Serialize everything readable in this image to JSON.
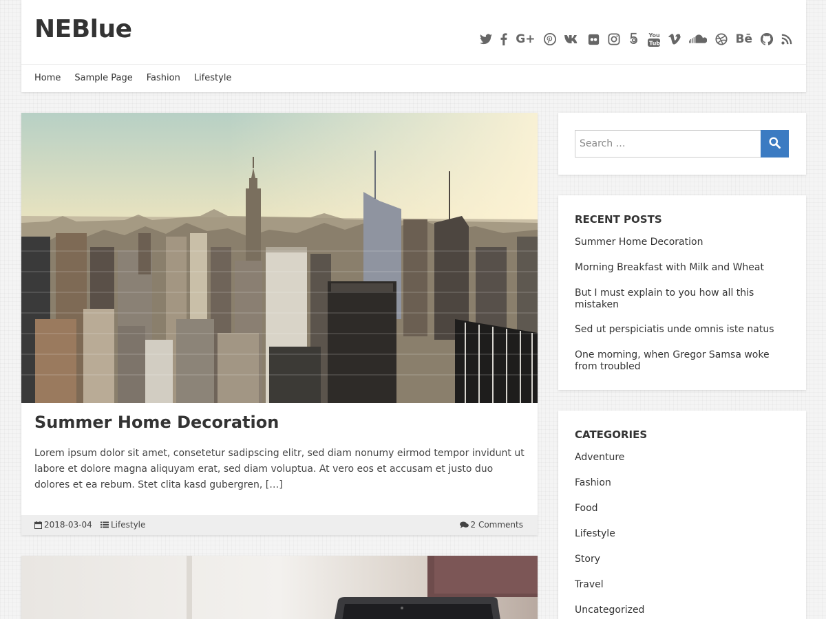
{
  "site": {
    "title": "NEBlue"
  },
  "social_icons": [
    "twitter-icon",
    "facebook-icon",
    "google-plus-icon",
    "pinterest-icon",
    "vk-icon",
    "flickr-icon",
    "instagram-icon",
    "500px-icon",
    "youtube-icon",
    "vimeo-icon",
    "soundcloud-icon",
    "dribbble-icon",
    "behance-icon",
    "github-icon",
    "rss-icon"
  ],
  "nav": {
    "items": [
      "Home",
      "Sample Page",
      "Fashion",
      "Lifestyle"
    ]
  },
  "post": {
    "title": "Summer Home Decoration",
    "excerpt": "Lorem ipsum dolor sit amet, consetetur sadipscing elitr, sed diam nonumy eirmod tempor invidunt ut labore et dolore magna aliquyam erat, sed diam voluptua. At vero eos et accusam et justo duo dolores et ea rebum. Stet clita kasd gubergren, […]",
    "date": "2018-03-04",
    "category": "Lifestyle",
    "comments": "2 Comments"
  },
  "search": {
    "placeholder": "Search …"
  },
  "recent_posts": {
    "title": "RECENT POSTS",
    "items": [
      "Summer Home Decoration",
      "Morning Breakfast with Milk and Wheat",
      "But I must explain to you how all this mistaken",
      "Sed ut perspiciatis unde omnis iste natus",
      "One morning, when Gregor Samsa woke from troubled"
    ]
  },
  "categories": {
    "title": "CATEGORIES",
    "items": [
      "Adventure",
      "Fashion",
      "Food",
      "Lifestyle",
      "Story",
      "Travel",
      "Uncategorized"
    ]
  },
  "colors": {
    "accent": "#3b7bc2",
    "text": "#333333",
    "footer_bg": "#eeeeee"
  }
}
